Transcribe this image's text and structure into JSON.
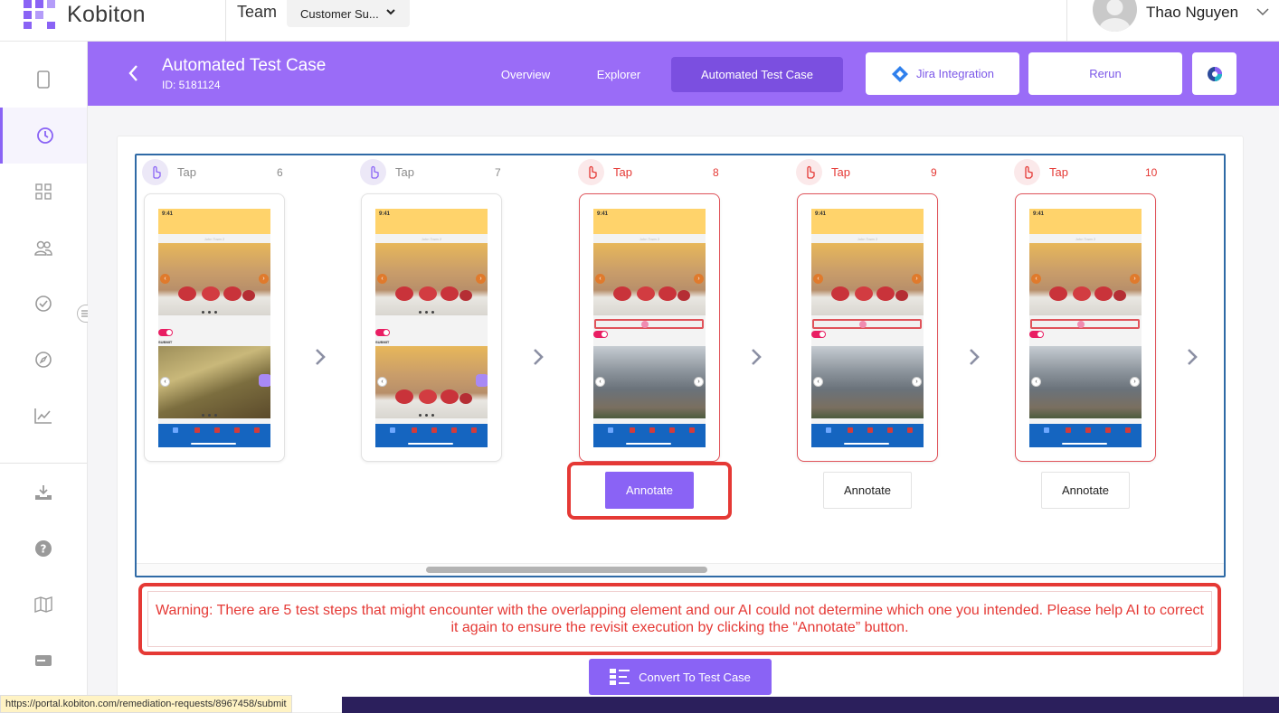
{
  "app": {
    "brand": "Kobiton"
  },
  "topbar": {
    "team_label": "Team",
    "team_select": "Customer Su...",
    "user_name": "Thao Nguyen"
  },
  "header": {
    "title": "Automated Test Case",
    "subtitle": "ID: 5181124",
    "tabs": [
      {
        "label": "Overview"
      },
      {
        "label": "Explorer"
      },
      {
        "label": "Automated Test Case"
      }
    ],
    "jira_label": "Jira Integration",
    "rerun_label": "Rerun"
  },
  "sidebar": {
    "items": [
      {
        "icon": "device-icon"
      },
      {
        "icon": "clock-icon",
        "active": true
      },
      {
        "icon": "apps-grid-icon"
      },
      {
        "icon": "users-icon"
      },
      {
        "icon": "check-circle-icon"
      },
      {
        "icon": "compass-icon"
      },
      {
        "icon": "chart-line-icon"
      },
      {
        "icon": "download-tray-icon"
      },
      {
        "icon": "help-icon"
      },
      {
        "icon": "map-icon"
      },
      {
        "icon": "card-icon"
      }
    ]
  },
  "steps": [
    {
      "action": "Tap",
      "number": "6",
      "warn": false
    },
    {
      "action": "Tap",
      "number": "7",
      "warn": false
    },
    {
      "action": "Tap",
      "number": "8",
      "warn": true
    },
    {
      "action": "Tap",
      "number": "9",
      "warn": true
    },
    {
      "action": "Tap",
      "number": "10",
      "warn": true
    }
  ],
  "phone": {
    "time": "9:41",
    "caption_top": "John Town 2",
    "caption_mid": "John Town 3",
    "caption_bottom": "John Town",
    "submit": "SUBMIT"
  },
  "annotate_label": "Annotate",
  "warning": "Warning: There are 5 test steps that might encounter with the overlapping element and our AI could not determine which one you intended. Please help AI to correct it again to ensure the revisit execution by clicking the “Annotate” button.",
  "convert_label": "Convert To Test Case",
  "status_url": "https://portal.kobiton.com/remediation-requests/8967458/submit",
  "colors": {
    "accent": "#9a6cf7",
    "primary": "#8a63f5",
    "warning": "#e53935",
    "jira": "#2f80ed"
  }
}
